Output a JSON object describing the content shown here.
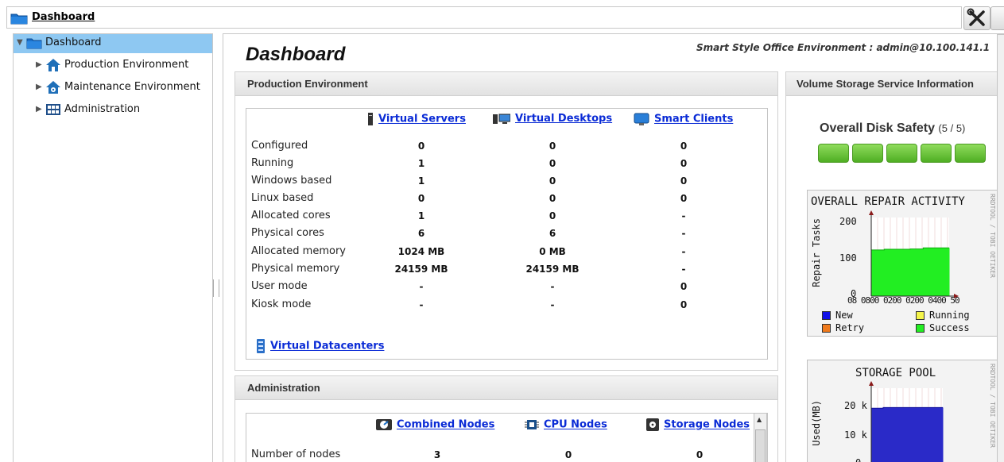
{
  "breadcrumb": {
    "label": "Dashboard"
  },
  "tree": {
    "root": "Dashboard",
    "items": [
      "Production Environment",
      "Maintenance Environment",
      "Administration"
    ]
  },
  "page": {
    "title": "Dashboard",
    "environment_line": "Smart Style Office Environment : admin@10.100.141.1"
  },
  "production": {
    "title": "Production Environment",
    "columns": [
      "Virtual Servers",
      "Virtual Desktops",
      "Smart Clients"
    ],
    "rows": [
      {
        "label": "Configured",
        "values": [
          "0",
          "0",
          "0"
        ]
      },
      {
        "label": "Running",
        "values": [
          "1",
          "0",
          "0"
        ]
      },
      {
        "label": "Windows based",
        "values": [
          "1",
          "0",
          "0"
        ]
      },
      {
        "label": "Linux based",
        "values": [
          "0",
          "0",
          "0"
        ]
      },
      {
        "label": "Allocated cores",
        "values": [
          "1",
          "0",
          "-"
        ]
      },
      {
        "label": "Physical cores",
        "values": [
          "6",
          "6",
          "-"
        ]
      },
      {
        "label": "Allocated memory",
        "values": [
          "1024 MB",
          "0 MB",
          "-"
        ]
      },
      {
        "label": "Physical memory",
        "values": [
          "24159 MB",
          "24159 MB",
          "-"
        ]
      },
      {
        "label": "User mode",
        "values": [
          "-",
          "-",
          "0"
        ]
      },
      {
        "label": "Kiosk mode",
        "values": [
          "-",
          "-",
          "0"
        ]
      }
    ],
    "datacenters_link": "Virtual Datacenters"
  },
  "administration": {
    "title": "Administration",
    "columns": [
      "Combined Nodes",
      "CPU Nodes",
      "Storage Nodes"
    ],
    "rows": [
      {
        "label": "Number of nodes",
        "values": [
          "3",
          "0",
          "0"
        ]
      }
    ]
  },
  "storage_panel": {
    "title": "Volume Storage Service Information",
    "safety_label": "Overall Disk Safety",
    "safety_fraction": "(5 / 5)",
    "safety_blocks": 5
  },
  "repair_chart": {
    "title": "OVERALL REPAIR ACTIVITY",
    "watermark": "RRDTOOL / TOBI OETIKER",
    "ylabel": "Repair Tasks",
    "yticks": [
      "200",
      "100",
      "0"
    ],
    "xticks": "08 0800 0200 0200 0400 50",
    "legend": [
      "New",
      "Running",
      "Retry",
      "Success"
    ],
    "legend_colors": [
      "#1010e8",
      "#f4f44a",
      "#f07a1c",
      "#22ee22"
    ]
  },
  "pool_chart": {
    "title": "STORAGE POOL",
    "watermark": "RRDTOOL / TOBI OETIKER",
    "ylabel": "Used(MB)",
    "yticks": [
      "20 k",
      "10 k",
      "0"
    ]
  },
  "chart_data": [
    {
      "type": "area",
      "title": "OVERALL REPAIR ACTIVITY",
      "ylabel": "Repair Tasks",
      "ylim": [
        0,
        230
      ],
      "series": [
        {
          "name": "Success",
          "values": [
            135,
            137,
            137,
            138,
            141,
            141
          ]
        }
      ]
    },
    {
      "type": "area",
      "title": "STORAGE POOL",
      "ylabel": "Used(MB)",
      "ylim": [
        0,
        25000
      ],
      "series": [
        {
          "values": [
            19000,
            19200,
            19200,
            19200,
            19200,
            19200
          ]
        }
      ]
    }
  ]
}
